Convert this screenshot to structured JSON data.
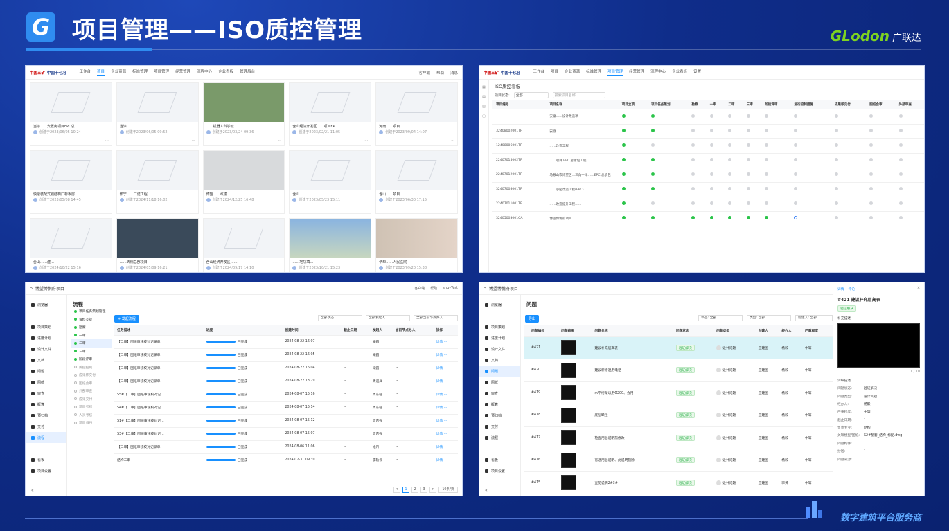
{
  "slide": {
    "title": "项目管理——ISO质控管理",
    "logo_letter": "G",
    "brand_en": "GLodon",
    "brand_cn": "广联达",
    "footer": "数字建筑平台服务商"
  },
  "p1": {
    "logo1": "中国五矿",
    "logo2": "中国十七冶",
    "nav": [
      "工作台",
      "项目",
      "企业资源",
      "标准管理",
      "项目管理",
      "经营管理",
      "流程中心",
      "企业看板",
      "管理后台"
    ],
    "active_nav": "项目",
    "right": [
      "客户端",
      "帮助",
      "消息"
    ],
    "cards": [
      {
        "name": "当涂……安置房项目EPC总…",
        "meta": "创建于2023/06/05 10:24",
        "img": "blank"
      },
      {
        "name": "当涂……",
        "meta": "创建于2023/06/05 09:52",
        "img": "blank"
      },
      {
        "name": "……机器人科学城",
        "meta": "创建于2023/03/24 09:36",
        "img": "green"
      },
      {
        "name": "含山经济开发区……项目EP…",
        "meta": "创建于2023/02/21 11:05",
        "img": "blank"
      },
      {
        "name": "河南……项目",
        "meta": "创建于2023/09/04 14:07",
        "img": "blank"
      },
      {
        "name": "快速装配式钢结构厂标板房",
        "meta": "创建于2023/05/08 14:45",
        "img": "blank"
      },
      {
        "name": "怀宁……厂建工程",
        "meta": "创建于2024/11/18 16:02",
        "img": "blank"
      },
      {
        "name": "博望……政楼…",
        "meta": "创建于2024/12/25 16:48",
        "img": "grey"
      },
      {
        "name": "含山……",
        "meta": "创建于2023/05/23 15:11",
        "img": "blank"
      },
      {
        "name": "含山……项目",
        "meta": "创建于2023/06/30 17:15",
        "img": "blank"
      },
      {
        "name": "含山……建…",
        "meta": "创建于2024/10/22 15:16",
        "img": "blank"
      },
      {
        "name": "……天赐总部项目",
        "meta": "创建于2024/05/09 16:21",
        "img": "dark"
      },
      {
        "name": "含山经济开发区……",
        "meta": "创建于2024/09/17 14:10",
        "img": "blank"
      },
      {
        "name": "……地块填…",
        "meta": "创建于2023/10/21 15:23",
        "img": "photo"
      },
      {
        "name": "伊犁……人民医院",
        "meta": "创建于2023/09/20 15:38",
        "img": "mix"
      }
    ]
  },
  "p2": {
    "page_title": "ISO质控看板",
    "filter_label": "项目状态:",
    "filter_value": "全部",
    "search_placeholder": "搜索项目名称",
    "headers": [
      "项目编号",
      "项目名称",
      "项目立项",
      "项目任务策划",
      "勘察",
      "一审",
      "二审",
      "三审",
      "阶段评审",
      "进行控制措施",
      "成果移交付",
      "图纸会审",
      "外部审查"
    ],
    "rows": [
      {
        "id": "",
        "name": "安徽……设计改造项",
        "st": [
          "g",
          "g",
          "x",
          "x",
          "x",
          "x",
          "x",
          "x",
          "x",
          "x",
          "x"
        ]
      },
      {
        "id": "32408002001TR",
        "name": "安徽……",
        "st": [
          "g",
          "g",
          "x",
          "x",
          "x",
          "x",
          "x",
          "x",
          "x",
          "x",
          "x"
        ]
      },
      {
        "id": "12408006001TR",
        "name": "……改造工程",
        "st": [
          "g",
          "x",
          "x",
          "x",
          "x",
          "x",
          "x",
          "x",
          "x",
          "x",
          "x"
        ]
      },
      {
        "id": "22407015002TR",
        "name": "……项目 EPC 总承包工程",
        "st": [
          "g",
          "g",
          "x",
          "x",
          "x",
          "x",
          "x",
          "x",
          "x",
          "x",
          "x"
        ]
      },
      {
        "id": "22407012001TR",
        "name": "马鞍山市博望区…三角一体……EPC 总承包",
        "st": [
          "g",
          "g",
          "x",
          "x",
          "x",
          "x",
          "x",
          "x",
          "x",
          "x",
          "x"
        ]
      },
      {
        "id": "32407008001TR",
        "name": "……小区改造工程(EPC)",
        "st": [
          "g",
          "g",
          "x",
          "x",
          "x",
          "x",
          "x",
          "x",
          "x",
          "x",
          "x"
        ]
      },
      {
        "id": "22407011001TR",
        "name": "……改造提升工程……",
        "st": [
          "g",
          "x",
          "x",
          "x",
          "x",
          "x",
          "x",
          "x",
          "x",
          "x",
          "x"
        ]
      },
      {
        "id": "32405003001CA",
        "name": "博望博悦府项目",
        "st": [
          "g",
          "g",
          "g",
          "g",
          "g",
          "g",
          "g",
          "b",
          "x",
          "x",
          "x"
        ]
      }
    ]
  },
  "p3": {
    "project": "博望博悦府项目",
    "right": [
      "客户端",
      "帮助",
      "shqyTest"
    ],
    "side": [
      "浏览器",
      "项目策划",
      "进度计划",
      "设计文件",
      "文档",
      "问题",
      "图纸",
      "审查",
      "概算",
      "预归档",
      "交付",
      "流程",
      "看板",
      "项目设置"
    ],
    "active": "流程",
    "section": "流程",
    "tree": [
      {
        "t": "项目任务策划管理",
        "g": false
      },
      {
        "t": "资料互提",
        "g": false
      },
      {
        "t": "勘察",
        "g": false
      },
      {
        "t": "一审",
        "g": false
      },
      {
        "t": "二审",
        "g": false,
        "sel": true
      },
      {
        "t": "三审",
        "g": false
      },
      {
        "t": "阶段评审",
        "g": false
      },
      {
        "t": "质控控制",
        "g": true
      },
      {
        "t": "成果移交付",
        "g": true
      },
      {
        "t": "图纸会审",
        "g": true
      },
      {
        "t": "外部审查",
        "g": true
      },
      {
        "t": "成果交付",
        "g": true
      },
      {
        "t": "项目考核",
        "g": true
      },
      {
        "t": "人员考核",
        "g": true
      },
      {
        "t": "项目归档",
        "g": true
      }
    ],
    "new_btn": "+ 发起流程",
    "filters": [
      "全部状态",
      "全部发起人",
      "全部当前节点办人"
    ],
    "headers": [
      "任务描述",
      "进度",
      "创建时间",
      "截止日期",
      "发起人",
      "当前节点办人",
      "操作"
    ],
    "rows": [
      {
        "d": "【二审】图纸审核校对记录单",
        "p": "已完成",
        "c": "2024-08-22 16:07",
        "e": "--",
        "by": "梁圆",
        "cur": "--"
      },
      {
        "d": "【二审】图纸审核校对记录单",
        "p": "已完成",
        "c": "2024-08-22 16:05",
        "e": "--",
        "by": "梁圆",
        "cur": "--"
      },
      {
        "d": "【二审】图纸审核校对记录单",
        "p": "已完成",
        "c": "2024-08-22 16:04",
        "e": "--",
        "by": "梁圆",
        "cur": "--"
      },
      {
        "d": "【二审】图纸审核校对记录单",
        "p": "已完成",
        "c": "2024-08-22 13:29",
        "e": "--",
        "by": "周道兵",
        "cur": "--"
      },
      {
        "d": "S5#【二审】图纸审核校对记…",
        "p": "已完成",
        "c": "2024-08-07 15:16",
        "e": "--",
        "by": "周东强",
        "cur": "--"
      },
      {
        "d": "S4#【二审】图纸审核校对记…",
        "p": "已完成",
        "c": "2024-08-07 15:14",
        "e": "--",
        "by": "周东强",
        "cur": "--"
      },
      {
        "d": "S1#【二审】图纸审核校对记…",
        "p": "已完成",
        "c": "2024-08-07 15:12",
        "e": "--",
        "by": "周东强",
        "cur": "--"
      },
      {
        "d": "S3#【二审】图纸审核校对记…",
        "p": "已完成",
        "c": "2024-08-07 15:07",
        "e": "--",
        "by": "周东强",
        "cur": "--"
      },
      {
        "d": "【二审】图纸审核校对记录单",
        "p": "已完成",
        "c": "2024-08-06 11:06",
        "e": "--",
        "by": "徐丹",
        "cur": "--"
      },
      {
        "d": "结构二审",
        "p": "已完成",
        "c": "2024-07-31 09:39",
        "e": "--",
        "by": "李轶云",
        "cur": "--"
      }
    ],
    "op": "详情",
    "pages": [
      "<",
      "1",
      "2",
      "3",
      ">",
      "10条/页"
    ]
  },
  "p4": {
    "project": "博望博悦府项目",
    "side": [
      "浏览器",
      "项目策划",
      "进度计划",
      "设计文件",
      "文档",
      "问题",
      "图纸",
      "审查",
      "概算",
      "预归档",
      "交付",
      "流程",
      "看板",
      "项目设置"
    ],
    "active": "问题",
    "section": "问题",
    "export_btn": "导出",
    "filters": [
      "状态: 全部",
      "类型: 全部",
      "创建人: 全部"
    ],
    "headers": [
      "问题编号",
      "问题截图",
      "问题名称",
      "问题状态",
      "问题类型",
      "创建人",
      "经办人",
      "严重程度"
    ],
    "rows": [
      {
        "id": "#421",
        "name": "建议补充层高表",
        "st": "验证解决",
        "type": "设计问题",
        "by": "王建国",
        "to": "杨毅",
        "sev": "中等",
        "hl": true
      },
      {
        "id": "#420",
        "name": "建议新增混用电话",
        "st": "验证解决",
        "type": "设计问题",
        "by": "王建国",
        "to": "杨毅",
        "sev": "中等",
        "hl": false
      },
      {
        "id": "#419",
        "name": "水平桁架以用Φ200、会用",
        "st": "验证解决",
        "type": "设计问题",
        "by": "王建国",
        "to": "杨毅",
        "sev": "中等",
        "hl": false
      },
      {
        "id": "#418",
        "name": "底层缺位",
        "st": "验证解决",
        "type": "设计问题",
        "by": "王建国",
        "to": "杨毅",
        "sev": "中等",
        "hl": false
      },
      {
        "id": "#417",
        "name": "检查用总说明前修改",
        "st": "验证解决",
        "type": "设计问题",
        "by": "王建国",
        "to": "杨毅",
        "sev": "中等",
        "hl": false
      },
      {
        "id": "#416",
        "name": "有通用总说明、此说明删除",
        "st": "验证解决",
        "type": "设计问题",
        "by": "王建国",
        "to": "杨毅",
        "sev": "中等",
        "hl": false
      },
      {
        "id": "#415",
        "name": "查见说明2#3#",
        "st": "验证解决",
        "type": "设计问题",
        "by": "王建国",
        "to": "李黄",
        "sev": "中等",
        "hl": false
      }
    ],
    "detail": {
      "tabs": [
        "详情",
        "评论"
      ],
      "title": "#421 建议补充层高表",
      "status": "验证解决",
      "desc_label": "补充描述",
      "count": "1 / 10",
      "section": "详细描述",
      "fields": [
        {
          "k": "问题状态:",
          "v": "验证解决"
        },
        {
          "k": "问题类型:",
          "v": "设计问题"
        },
        {
          "k": "经办人:",
          "v": "杨毅"
        },
        {
          "k": "严重程度:",
          "v": "中等"
        },
        {
          "k": "截止日期:",
          "v": "-"
        },
        {
          "k": "负责专业:",
          "v": "结构"
        },
        {
          "k": "关联模型/图纸:",
          "v": "S2#配套_结构_标配.dwg"
        },
        {
          "k": "问题构件:",
          "v": "-"
        },
        {
          "k": "抄送:",
          "v": "-"
        },
        {
          "k": "问题来源:",
          "v": "-"
        }
      ]
    }
  }
}
